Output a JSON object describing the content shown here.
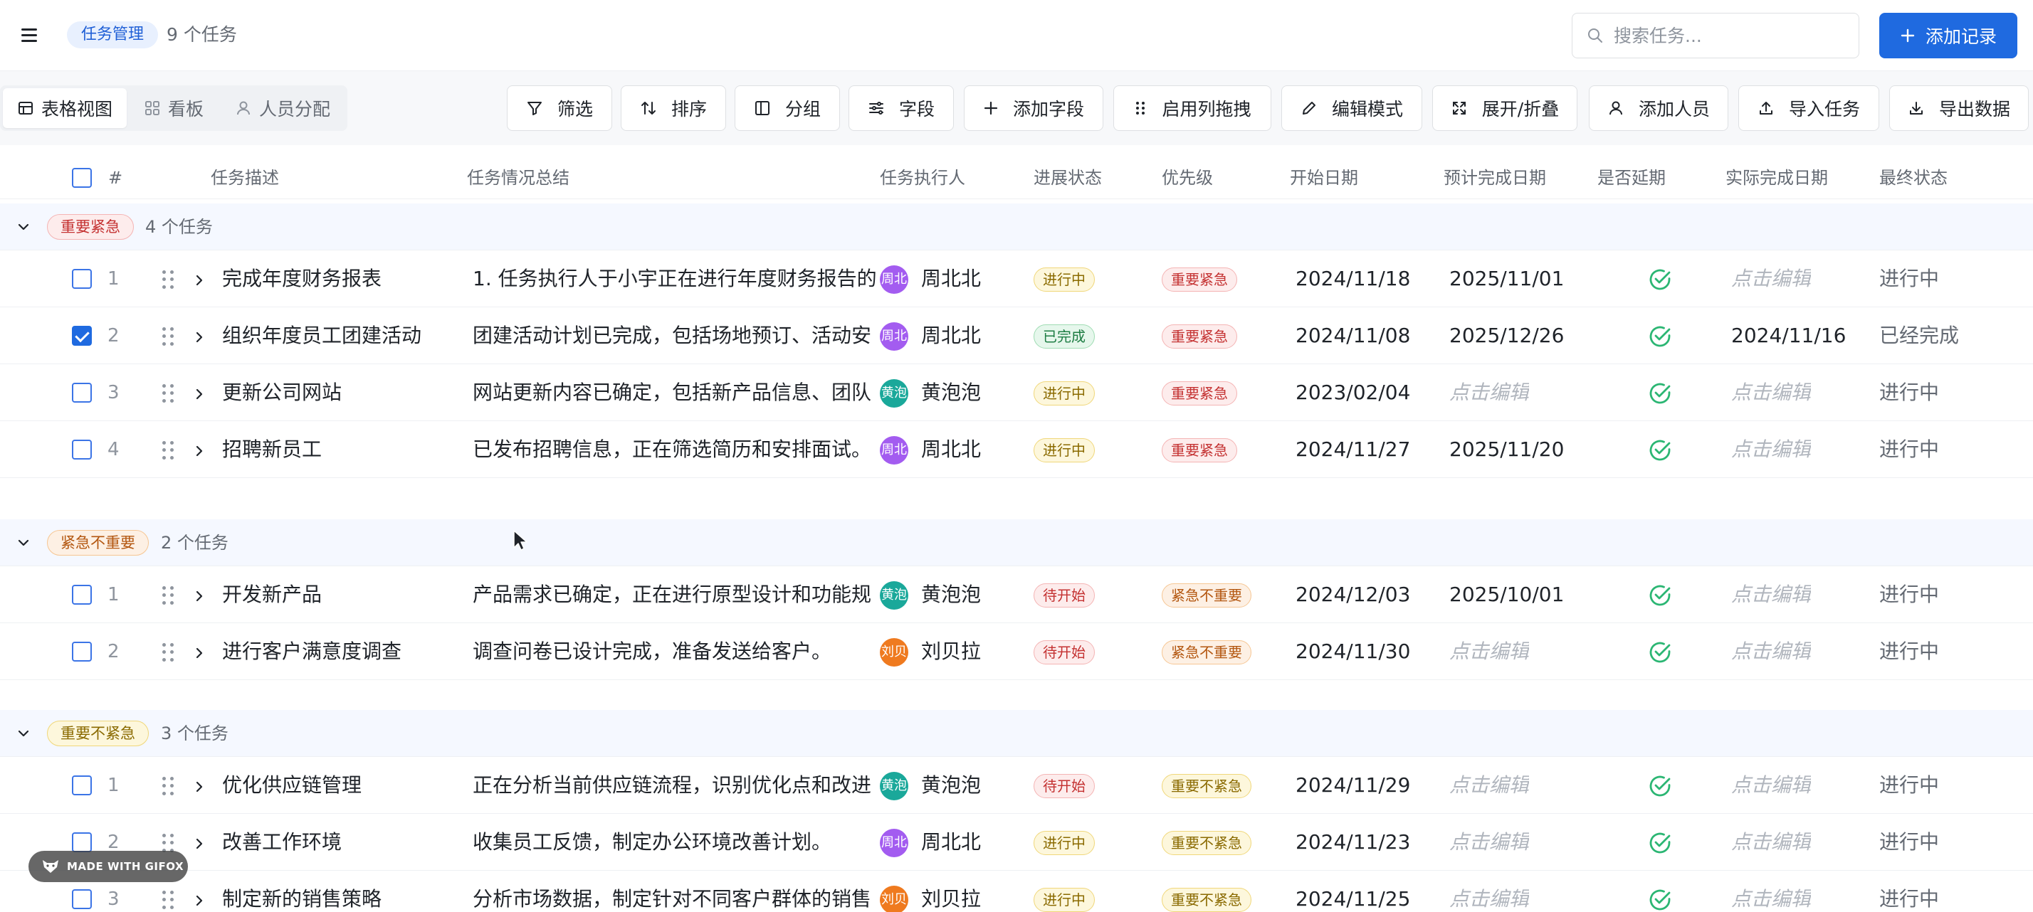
{
  "topbar": {
    "app_tag": "任务管理",
    "task_count": "9 个任务",
    "search_placeholder": "搜索任务...",
    "add_record_label": "添加记录"
  },
  "toolbar": {
    "views": [
      "表格视图",
      "看板",
      "人员分配"
    ],
    "buttons": [
      "筛选",
      "排序",
      "分组",
      "字段",
      "添加字段",
      "启用列拖拽",
      "编辑模式",
      "展开/折叠",
      "添加人员",
      "导入任务",
      "导出数据"
    ]
  },
  "table": {
    "columns": [
      "#",
      "任务描述",
      "任务情况总结",
      "任务执行人",
      "进展状态",
      "优先级",
      "开始日期",
      "预计完成日期",
      "是否延期",
      "实际完成日期",
      "最终状态"
    ],
    "groups": [
      {
        "tag": "重要紧急",
        "count": "4 个任务",
        "rows": [
          {
            "num": "1",
            "checked": false,
            "desc": "完成年度财务报表",
            "summary": "1. 任务执行人于小宇正在进行年度财务报告的",
            "avatar": "周北",
            "owner": "周北北",
            "status": "进行中",
            "priority": "重要紧急",
            "start": "2024/11/18",
            "due": "2025/11/01",
            "actual": "点击编辑",
            "final": "进行中"
          },
          {
            "num": "2",
            "checked": true,
            "desc": "组织年度员工团建活动",
            "summary": "团建活动计划已完成，包括场地预订、活动安",
            "avatar": "周北",
            "owner": "周北北",
            "status": "已完成",
            "priority": "重要紧急",
            "start": "2024/11/08",
            "due": "2025/12/26",
            "actual": "2024/11/16",
            "final": "已经完成"
          },
          {
            "num": "3",
            "checked": false,
            "desc": "更新公司网站",
            "summary": "网站更新内容已确定，包括新产品信息、团队",
            "avatar": "黄泡",
            "owner": "黄泡泡",
            "status": "进行中",
            "priority": "重要紧急",
            "start": "2023/02/04",
            "due": "点击编辑",
            "actual": "点击编辑",
            "final": "进行中"
          },
          {
            "num": "4",
            "checked": false,
            "desc": "招聘新员工",
            "summary": "已发布招聘信息，正在筛选简历和安排面试。",
            "avatar": "周北",
            "owner": "周北北",
            "status": "进行中",
            "priority": "重要紧急",
            "start": "2024/11/27",
            "due": "2025/11/20",
            "actual": "点击编辑",
            "final": "进行中"
          }
        ]
      },
      {
        "tag": "紧急不重要",
        "count": "2 个任务",
        "rows": [
          {
            "num": "1",
            "checked": false,
            "desc": "开发新产品",
            "summary": "产品需求已确定，正在进行原型设计和功能规",
            "avatar": "黄泡",
            "owner": "黄泡泡",
            "status": "待开始",
            "priority": "紧急不重要",
            "start": "2024/12/03",
            "due": "2025/10/01",
            "actual": "点击编辑",
            "final": "进行中"
          },
          {
            "num": "2",
            "checked": false,
            "desc": "进行客户满意度调查",
            "summary": "调查问卷已设计完成，准备发送给客户。",
            "avatar": "刘贝",
            "owner": "刘贝拉",
            "status": "待开始",
            "priority": "紧急不重要",
            "start": "2024/11/30",
            "due": "点击编辑",
            "actual": "点击编辑",
            "final": "进行中"
          }
        ]
      },
      {
        "tag": "重要不紧急",
        "count": "3 个任务",
        "rows": [
          {
            "num": "1",
            "checked": false,
            "desc": "优化供应链管理",
            "summary": "正在分析当前供应链流程，识别优化点和改进",
            "avatar": "黄泡",
            "owner": "黄泡泡",
            "status": "待开始",
            "priority": "重要不紧急",
            "start": "2024/11/29",
            "due": "点击编辑",
            "actual": "点击编辑",
            "final": "进行中"
          },
          {
            "num": "2",
            "checked": false,
            "desc": "改善工作环境",
            "summary": "收集员工反馈，制定办公环境改善计划。",
            "avatar": "周北",
            "owner": "周北北",
            "status": "进行中",
            "priority": "重要不紧急",
            "start": "2024/11/23",
            "due": "点击编辑",
            "actual": "点击编辑",
            "final": "进行中"
          },
          {
            "num": "3",
            "checked": false,
            "desc": "制定新的销售策略",
            "summary": "分析市场数据，制定针对不同客户群体的销售",
            "avatar": "刘贝",
            "owner": "刘贝拉",
            "status": "进行中",
            "priority": "重要不紧急",
            "start": "2024/11/25",
            "due": "点击编辑",
            "actual": "点击编辑",
            "final": "进行中"
          }
        ]
      }
    ]
  },
  "watermark": "MADE WITH GIFOX",
  "colors": {
    "accent": "#1f6ae0",
    "avatar_purple": "#a35cf0",
    "avatar_teal": "#1aa89a",
    "avatar_orange": "#ef7a1f",
    "check_green": "#2bb673"
  }
}
